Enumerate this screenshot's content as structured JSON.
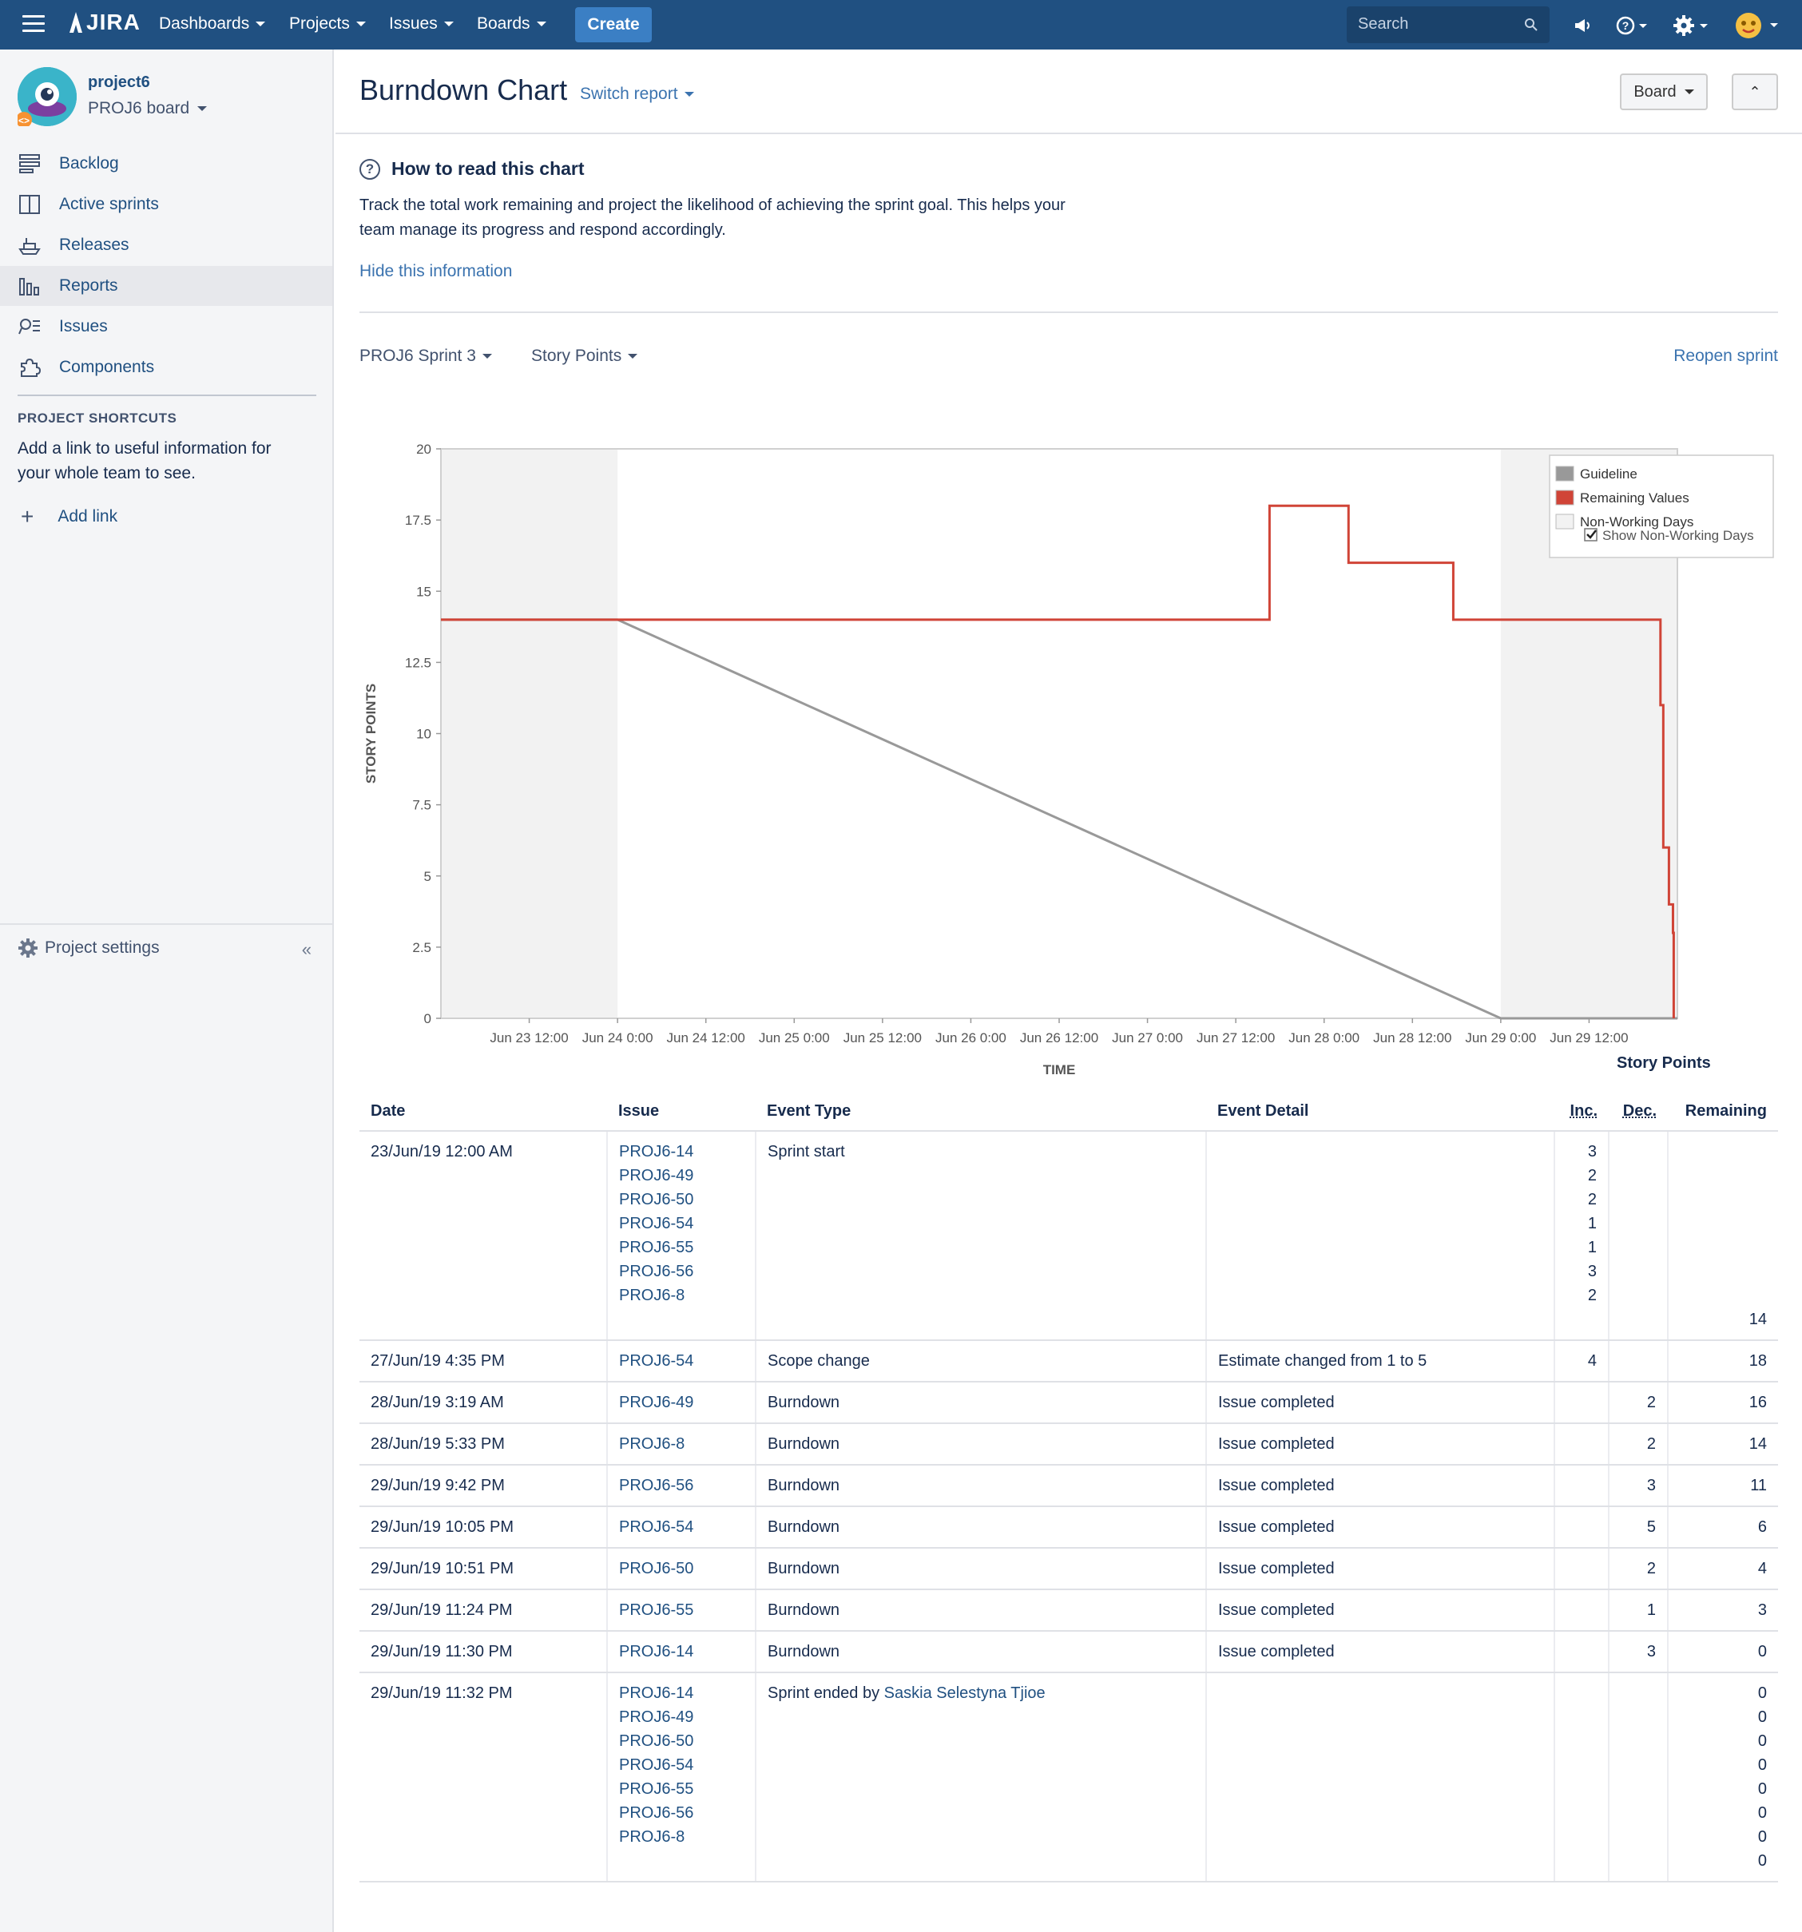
{
  "nav": {
    "logo_text": "JIRA",
    "menus": [
      {
        "label": "Dashboards"
      },
      {
        "label": "Projects"
      },
      {
        "label": "Issues"
      },
      {
        "label": "Boards"
      }
    ],
    "create_label": "Create",
    "search_placeholder": "Search",
    "accent": "#205081"
  },
  "sidebar": {
    "project_name": "project6",
    "board_name": "PROJ6 board",
    "items": [
      {
        "label": "Backlog",
        "icon": "backlog-icon"
      },
      {
        "label": "Active sprints",
        "icon": "board-icon"
      },
      {
        "label": "Releases",
        "icon": "ship-icon"
      },
      {
        "label": "Reports",
        "icon": "chart-icon",
        "active": true
      },
      {
        "label": "Issues",
        "icon": "issues-icon"
      },
      {
        "label": "Components",
        "icon": "puzzle-icon"
      }
    ],
    "shortcuts_title": "PROJECT SHORTCUTS",
    "shortcuts_desc": "Add a link to useful information for your whole team to see.",
    "add_link": "Add link",
    "project_settings": "Project settings"
  },
  "header": {
    "title": "Burndown Chart",
    "switch_report": "Switch report",
    "board_button": "Board"
  },
  "help": {
    "title": "How to read this chart",
    "text": "Track the total work remaining and project the likelihood of achieving the sprint goal. This helps your team manage its progress and respond accordingly.",
    "hide_link": "Hide this information"
  },
  "controls": {
    "sprint": "PROJ6 Sprint 3",
    "estimation": "Story Points",
    "reopen": "Reopen sprint"
  },
  "chart_data": {
    "type": "line",
    "xlabel": "TIME",
    "ylabel": "STORY POINTS",
    "ylim": [
      0,
      20
    ],
    "yticks": [
      "0",
      "2.5",
      "5",
      "7.5",
      "10",
      "12.5",
      "15",
      "17.5",
      "20"
    ],
    "xlim": [
      "2019-06-23 00:00",
      "2019-06-30 00:00"
    ],
    "xticks": [
      "Jun 23 12:00",
      "Jun 24 0:00",
      "Jun 24 12:00",
      "Jun 25 0:00",
      "Jun 25 12:00",
      "Jun 26 0:00",
      "Jun 26 12:00",
      "Jun 27 0:00",
      "Jun 27 12:00",
      "Jun 28 0:00",
      "Jun 28 12:00",
      "Jun 29 0:00",
      "Jun 29 12:00"
    ],
    "non_working_periods": [
      [
        "2019-06-23 00:00",
        "2019-06-24 00:00"
      ],
      [
        "2019-06-29 00:00",
        "2019-06-30 00:00"
      ]
    ],
    "series": [
      {
        "name": "Guideline",
        "color": "#999999",
        "points": [
          [
            "2019-06-23 00:00",
            14
          ],
          [
            "2019-06-24 00:00",
            14
          ],
          [
            "2019-06-29 00:00",
            0
          ],
          [
            "2019-06-30 00:00",
            0
          ]
        ]
      },
      {
        "name": "Remaining Values",
        "color": "#d04437",
        "step": true,
        "points": [
          [
            "2019-06-23 00:00",
            14
          ],
          [
            "2019-06-27 16:35",
            18
          ],
          [
            "2019-06-28 03:19",
            16
          ],
          [
            "2019-06-28 17:33",
            14
          ],
          [
            "2019-06-29 21:42",
            11
          ],
          [
            "2019-06-29 22:05",
            6
          ],
          [
            "2019-06-29 22:51",
            4
          ],
          [
            "2019-06-29 23:24",
            3
          ],
          [
            "2019-06-29 23:30",
            0
          ]
        ]
      }
    ],
    "legend": {
      "position": "top-right",
      "items": [
        {
          "label": "Guideline",
          "color": "#999999"
        },
        {
          "label": "Remaining Values",
          "color": "#d04437"
        },
        {
          "label": "Non-Working Days",
          "color": "#f2f2f2"
        }
      ],
      "checkbox_label": "Show Non-Working Days",
      "checked": true
    }
  },
  "table": {
    "group_header": "Story Points",
    "columns": [
      "Date",
      "Issue",
      "Event Type",
      "Event Detail",
      "Inc.",
      "Dec.",
      "Remaining"
    ],
    "rows": [
      {
        "date": "23/Jun/19 12:00 AM",
        "issues": [
          "PROJ6-14",
          "PROJ6-49",
          "PROJ6-50",
          "PROJ6-54",
          "PROJ6-55",
          "PROJ6-56",
          "PROJ6-8"
        ],
        "event": "Sprint start",
        "detail": "",
        "inc": [
          "3",
          "2",
          "2",
          "1",
          "1",
          "3",
          "2"
        ],
        "dec": [],
        "remaining": [
          "",
          "",
          "",
          "",
          "",
          "",
          "",
          "14"
        ]
      },
      {
        "date": "27/Jun/19 4:35 PM",
        "issues": [
          "PROJ6-54"
        ],
        "event": "Scope change",
        "detail": "Estimate changed from 1 to 5",
        "inc": [
          "4"
        ],
        "dec": [],
        "remaining": [
          "18"
        ]
      },
      {
        "date": "28/Jun/19 3:19 AM",
        "issues": [
          "PROJ6-49"
        ],
        "event": "Burndown",
        "detail": "Issue completed",
        "inc": [],
        "dec": [
          "2"
        ],
        "remaining": [
          "16"
        ]
      },
      {
        "date": "28/Jun/19 5:33 PM",
        "issues": [
          "PROJ6-8"
        ],
        "event": "Burndown",
        "detail": "Issue completed",
        "inc": [],
        "dec": [
          "2"
        ],
        "remaining": [
          "14"
        ]
      },
      {
        "date": "29/Jun/19 9:42 PM",
        "issues": [
          "PROJ6-56"
        ],
        "event": "Burndown",
        "detail": "Issue completed",
        "inc": [],
        "dec": [
          "3"
        ],
        "remaining": [
          "11"
        ]
      },
      {
        "date": "29/Jun/19 10:05 PM",
        "issues": [
          "PROJ6-54"
        ],
        "event": "Burndown",
        "detail": "Issue completed",
        "inc": [],
        "dec": [
          "5"
        ],
        "remaining": [
          "6"
        ]
      },
      {
        "date": "29/Jun/19 10:51 PM",
        "issues": [
          "PROJ6-50"
        ],
        "event": "Burndown",
        "detail": "Issue completed",
        "inc": [],
        "dec": [
          "2"
        ],
        "remaining": [
          "4"
        ]
      },
      {
        "date": "29/Jun/19 11:24 PM",
        "issues": [
          "PROJ6-55"
        ],
        "event": "Burndown",
        "detail": "Issue completed",
        "inc": [],
        "dec": [
          "1"
        ],
        "remaining": [
          "3"
        ]
      },
      {
        "date": "29/Jun/19 11:30 PM",
        "issues": [
          "PROJ6-14"
        ],
        "event": "Burndown",
        "detail": "Issue completed",
        "inc": [],
        "dec": [
          "3"
        ],
        "remaining": [
          "0"
        ]
      },
      {
        "date": "29/Jun/19 11:32 PM",
        "issues": [
          "PROJ6-14",
          "PROJ6-49",
          "PROJ6-50",
          "PROJ6-54",
          "PROJ6-55",
          "PROJ6-56",
          "PROJ6-8"
        ],
        "event": "Sprint ended by",
        "event_user": "Saskia Selestyna Tjioe",
        "detail": "",
        "inc": [],
        "dec": [],
        "remaining": [
          "0",
          "0",
          "0",
          "0",
          "0",
          "0",
          "0",
          "0"
        ]
      }
    ]
  }
}
